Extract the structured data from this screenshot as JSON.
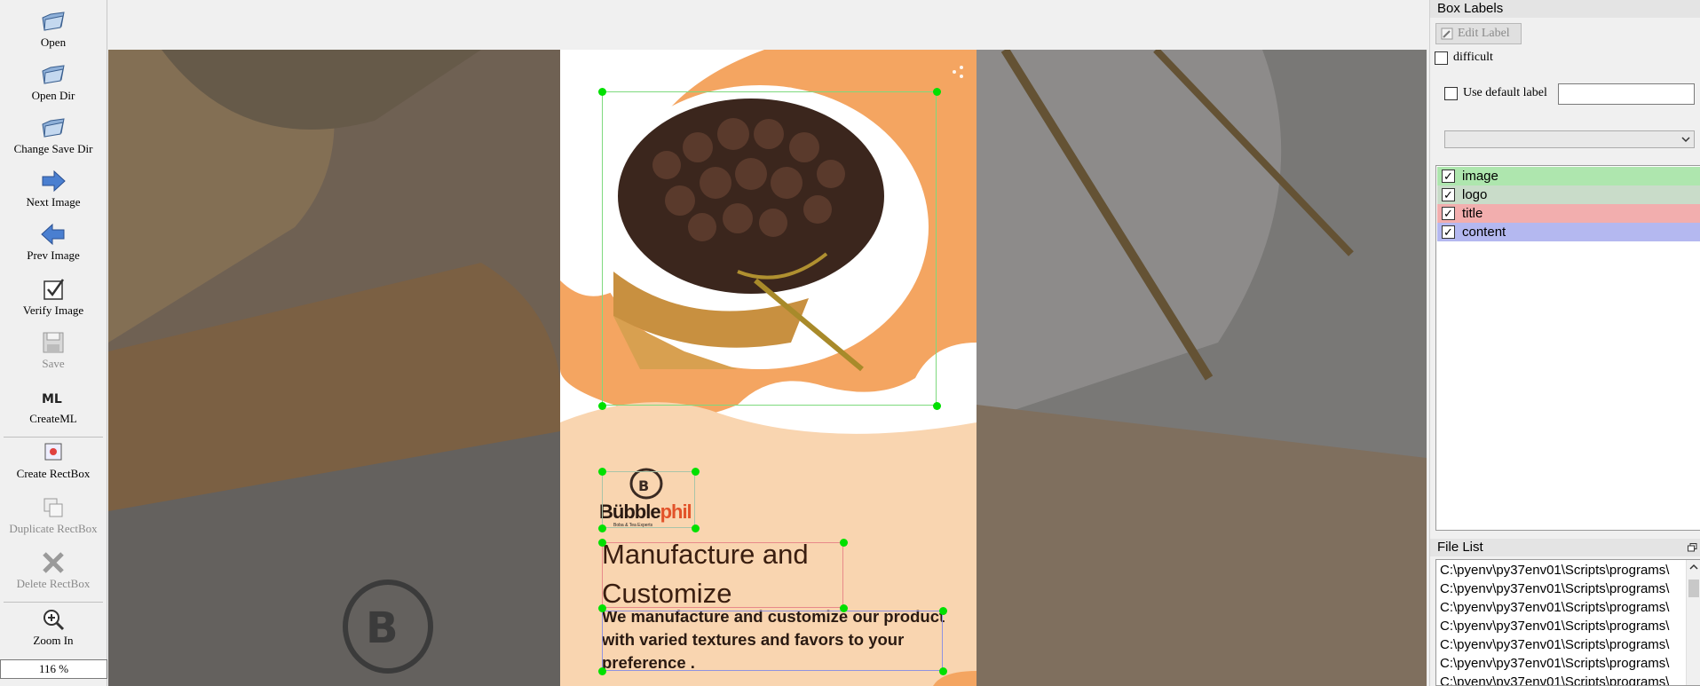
{
  "toolbar": {
    "open": "Open",
    "open_dir": "Open Dir",
    "change_save_dir": "Change Save Dir",
    "next_image": "Next Image",
    "prev_image": "Prev Image",
    "verify_image": "Verify Image",
    "save": "Save",
    "create_ml": "CreateML",
    "create_rectbox": "Create RectBox",
    "duplicate_rectbox": "Duplicate RectBox",
    "delete_rectbox": "Delete RectBox",
    "zoom_in": "Zoom In",
    "zoom_level": "116 %"
  },
  "poster": {
    "title": "Manufacture and Customize",
    "content": "We manufacture and customize our product with varied textures and favors to your preference .",
    "logo_word_a": "Bübble",
    "logo_word_b": "phil",
    "logo_sub": "Boba & Tea Experts"
  },
  "right_panel": {
    "box_labels_title": "Box Labels",
    "edit_label": "Edit Label",
    "difficult": "difficult",
    "use_default_label": "Use default label",
    "default_label_value": "",
    "labels": [
      {
        "name": "image",
        "checked": true,
        "color": "#aee6ae"
      },
      {
        "name": "logo",
        "checked": true,
        "color": "#c9dcc9"
      },
      {
        "name": "title",
        "checked": true,
        "color": "#f2aeae"
      },
      {
        "name": "content",
        "checked": true,
        "color": "#b4b8f0"
      }
    ],
    "file_list_title": "File List",
    "files": [
      "C:\\pyenv\\py37env01\\Scripts\\programs\\",
      "C:\\pyenv\\py37env01\\Scripts\\programs\\",
      "C:\\pyenv\\py37env01\\Scripts\\programs\\",
      "C:\\pyenv\\py37env01\\Scripts\\programs\\",
      "C:\\pyenv\\py37env01\\Scripts\\programs\\",
      "C:\\pyenv\\py37env01\\Scripts\\programs\\",
      "C:\\pyenv\\py37env01\\Scripts\\programs\\"
    ]
  },
  "colors": {
    "image_box": "#7ed97e",
    "logo_box": "#a9c4a9",
    "title_box": "#e88a8a",
    "content_box": "#8f93e0",
    "handle": "#00e000",
    "orange": "#f4a561",
    "peach": "#f9d5b0"
  }
}
